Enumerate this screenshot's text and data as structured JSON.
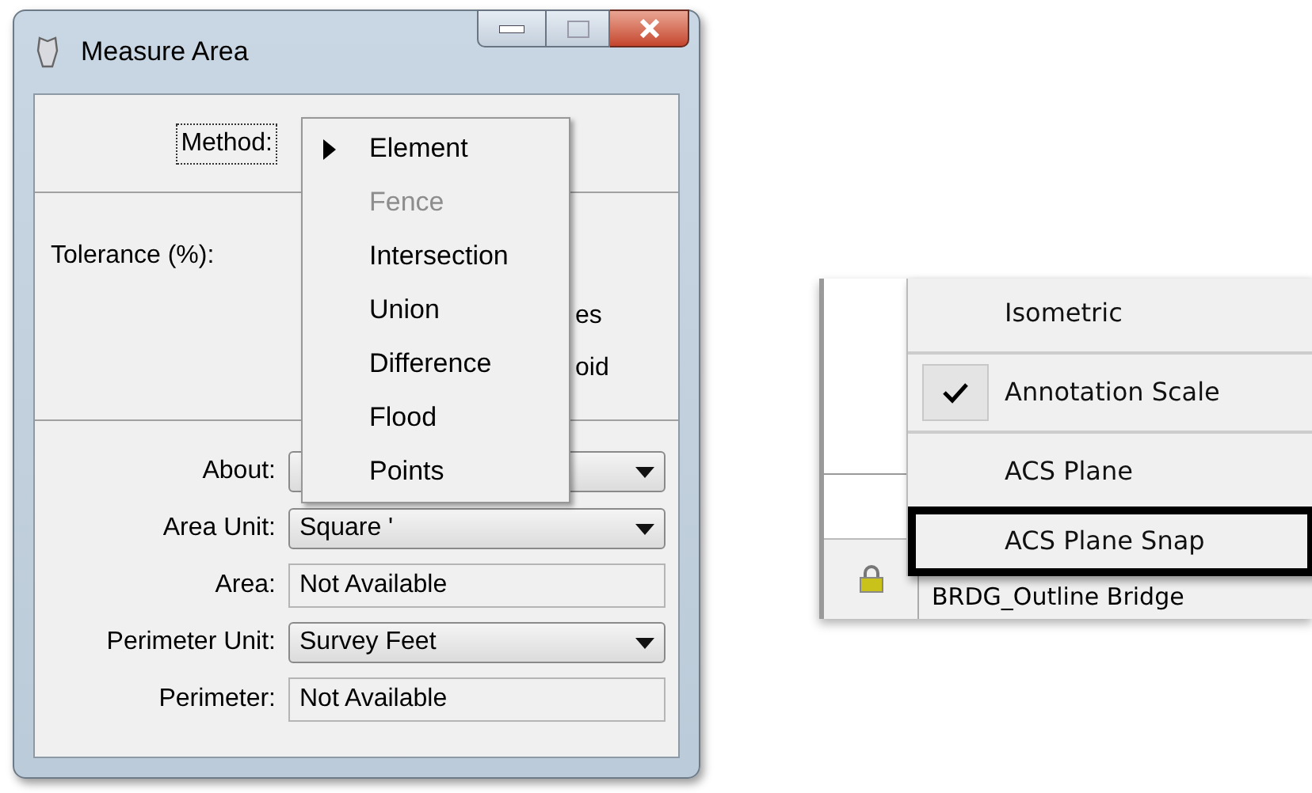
{
  "window": {
    "title": "Measure Area"
  },
  "method": {
    "label": "Method:",
    "focused": true
  },
  "method_menu": {
    "items": [
      {
        "label": "Element",
        "selected": true,
        "disabled": false
      },
      {
        "label": "Fence",
        "selected": false,
        "disabled": true
      },
      {
        "label": "Intersection",
        "selected": false,
        "disabled": false
      },
      {
        "label": "Union",
        "selected": false,
        "disabled": false
      },
      {
        "label": "Difference",
        "selected": false,
        "disabled": false
      },
      {
        "label": "Flood",
        "selected": false,
        "disabled": false
      },
      {
        "label": "Points",
        "selected": false,
        "disabled": false
      }
    ]
  },
  "tolerance": {
    "label": "Tolerance (%):"
  },
  "covered_options": [
    "es",
    "oid"
  ],
  "fields": [
    {
      "kind": "dropdown",
      "label": "About:"
    },
    {
      "kind": "dropdown",
      "label": "Area Unit:",
      "value": "Square '"
    },
    {
      "kind": "readout",
      "label": "Area:",
      "value": "Not Available"
    },
    {
      "kind": "dropdown",
      "label": "Perimeter Unit:",
      "value": "Survey Feet"
    },
    {
      "kind": "readout",
      "label": "Perimeter:",
      "value": "Not Available"
    }
  ],
  "context_menu": {
    "items": [
      {
        "kind": "item",
        "label": "Isometric",
        "checked": false,
        "highlighted": false
      },
      {
        "kind": "separator"
      },
      {
        "kind": "item",
        "label": "Annotation Scale",
        "checked": true,
        "highlighted": false
      },
      {
        "kind": "separator"
      },
      {
        "kind": "item",
        "label": "ACS Plane",
        "checked": false,
        "highlighted": false
      },
      {
        "kind": "item",
        "label": "ACS Plane Snap",
        "checked": false,
        "highlighted": true
      }
    ]
  },
  "status_bar": {
    "text": "BRDG_Outline Bridge"
  }
}
